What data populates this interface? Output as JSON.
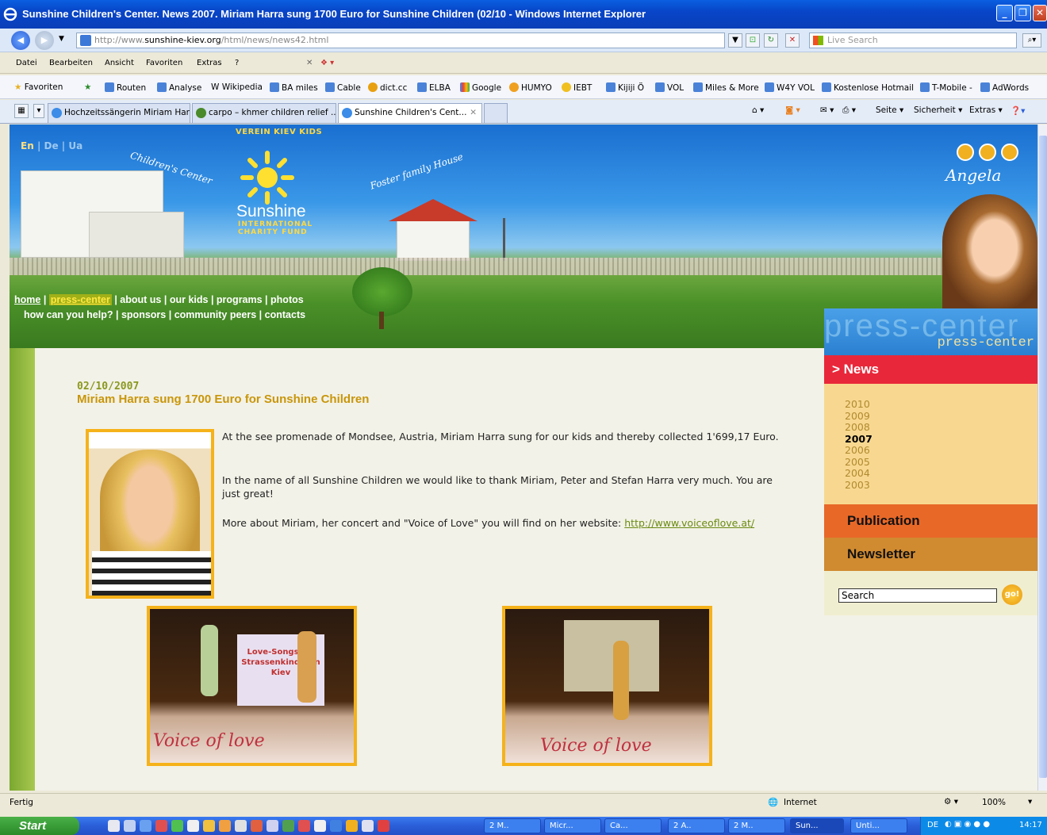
{
  "window": {
    "title": "Sunshine Children's Center. News 2007. Miriam Harra sung 1700 Euro for Sunshine Children (02/10 - Windows Internet Explorer"
  },
  "address": {
    "prefix": "http://www.",
    "domain": "sunshine-kiev.org",
    "path": "/html/news/news42.html",
    "search_placeholder": "Live Search"
  },
  "menu": [
    "Datei",
    "Bearbeiten",
    "Ansicht",
    "Favoriten",
    "Extras",
    "?"
  ],
  "favorites": {
    "label": "Favoriten",
    "items": [
      "Routen",
      "Analyse",
      "Wikipedia",
      "BA miles",
      "Cable",
      "dict.cc",
      "ELBA",
      "Google",
      "HUMYO",
      "IEBT",
      "Kijiji Ö",
      "VOL",
      "Miles & More",
      "W4Y VOL",
      "Kostenlose Hotmail",
      "T-Mobile -",
      "AdWords"
    ]
  },
  "tabs": [
    {
      "label": "Hochzeitssängerin Miriam Har..."
    },
    {
      "label": "carpo – khmer children relief ..."
    },
    {
      "label": "Sunshine Children's Cent..."
    }
  ],
  "commandbar": [
    "Seite ▾",
    "Sicherheit ▾",
    "Extras ▾"
  ],
  "site": {
    "langs": [
      "En",
      "De",
      "Ua"
    ],
    "verein": "VEREIN KIEV KIDS",
    "brand": "Sunshine",
    "charity": "INTERNATIONAL CHARITY FUND",
    "childrens_center": "Children's Center",
    "foster": "Foster family House",
    "angela": "Angela",
    "nav_row1": [
      "home",
      "press-center",
      "about us",
      "our kids",
      "programs",
      "photos"
    ],
    "nav_row2": [
      "how can you help?",
      "sponsors",
      "community peers",
      "contacts"
    ]
  },
  "article": {
    "date": "02/10/2007",
    "title": "Miriam Harra sung 1700 Euro for Sunshine Children",
    "p1": "At the see promenade of Mondsee, Austria, Miriam Harra sung for our kids and thereby collected 1'699,17 Euro.",
    "p2": "In the name of all Sunshine Children we would like to thank Miriam, Peter and Stefan Harra very much. You are just great!",
    "p3_prefix": "More about Miriam, her concert and \"Voice of Love\" you will find on her website: ",
    "p3_link": "http://www.voiceoflove.at/",
    "photo1_screen": "Love-Songs für Strassenkinder in Kiev",
    "photo_banner": "Voice of love"
  },
  "sidebar": {
    "press_big": "press-center",
    "press_small": "press-center",
    "news": "> News",
    "years": [
      "2010",
      "2009",
      "2008",
      "2007",
      "2006",
      "2005",
      "2004",
      "2003"
    ],
    "selected_year": "2007",
    "publication": "Publication",
    "newsletter": "Newsletter",
    "search_value": "Search",
    "go": "go!"
  },
  "status": {
    "text": "Fertig",
    "zone": "Internet",
    "zoom": "100%"
  },
  "taskbar": {
    "start": "Start",
    "tasks": [
      "2 M..",
      "Micr...",
      "Ca...",
      "2 A..",
      "2 M..",
      "Sun...",
      "Unti..."
    ],
    "lang": "DE",
    "clock": "14:17"
  },
  "colors": {
    "accent_red": "#e8283a",
    "accent_orange": "#e86828",
    "photo_border": "#f5b21a",
    "title_gold": "#c8960a"
  }
}
